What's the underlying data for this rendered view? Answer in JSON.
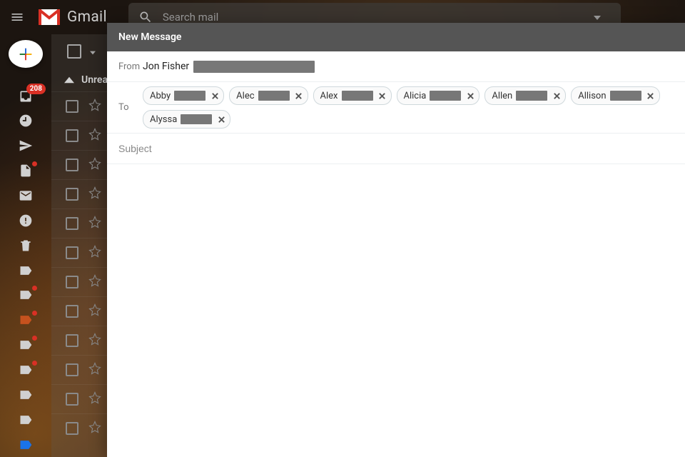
{
  "header": {
    "logo_text": "Gmail",
    "search_placeholder": "Search mail"
  },
  "rail": {
    "inbox_badge": "208"
  },
  "list": {
    "section_label": "Unread"
  },
  "compose": {
    "title": "New Message",
    "from_label": "From",
    "from_name": "Jon Fisher",
    "to_label": "To",
    "subject_placeholder": "Subject",
    "recipients": [
      {
        "name": "Abby"
      },
      {
        "name": "Alec"
      },
      {
        "name": "Alex"
      },
      {
        "name": "Alicia"
      },
      {
        "name": "Allen"
      },
      {
        "name": "Allison"
      },
      {
        "name": "Alyssa"
      }
    ]
  }
}
